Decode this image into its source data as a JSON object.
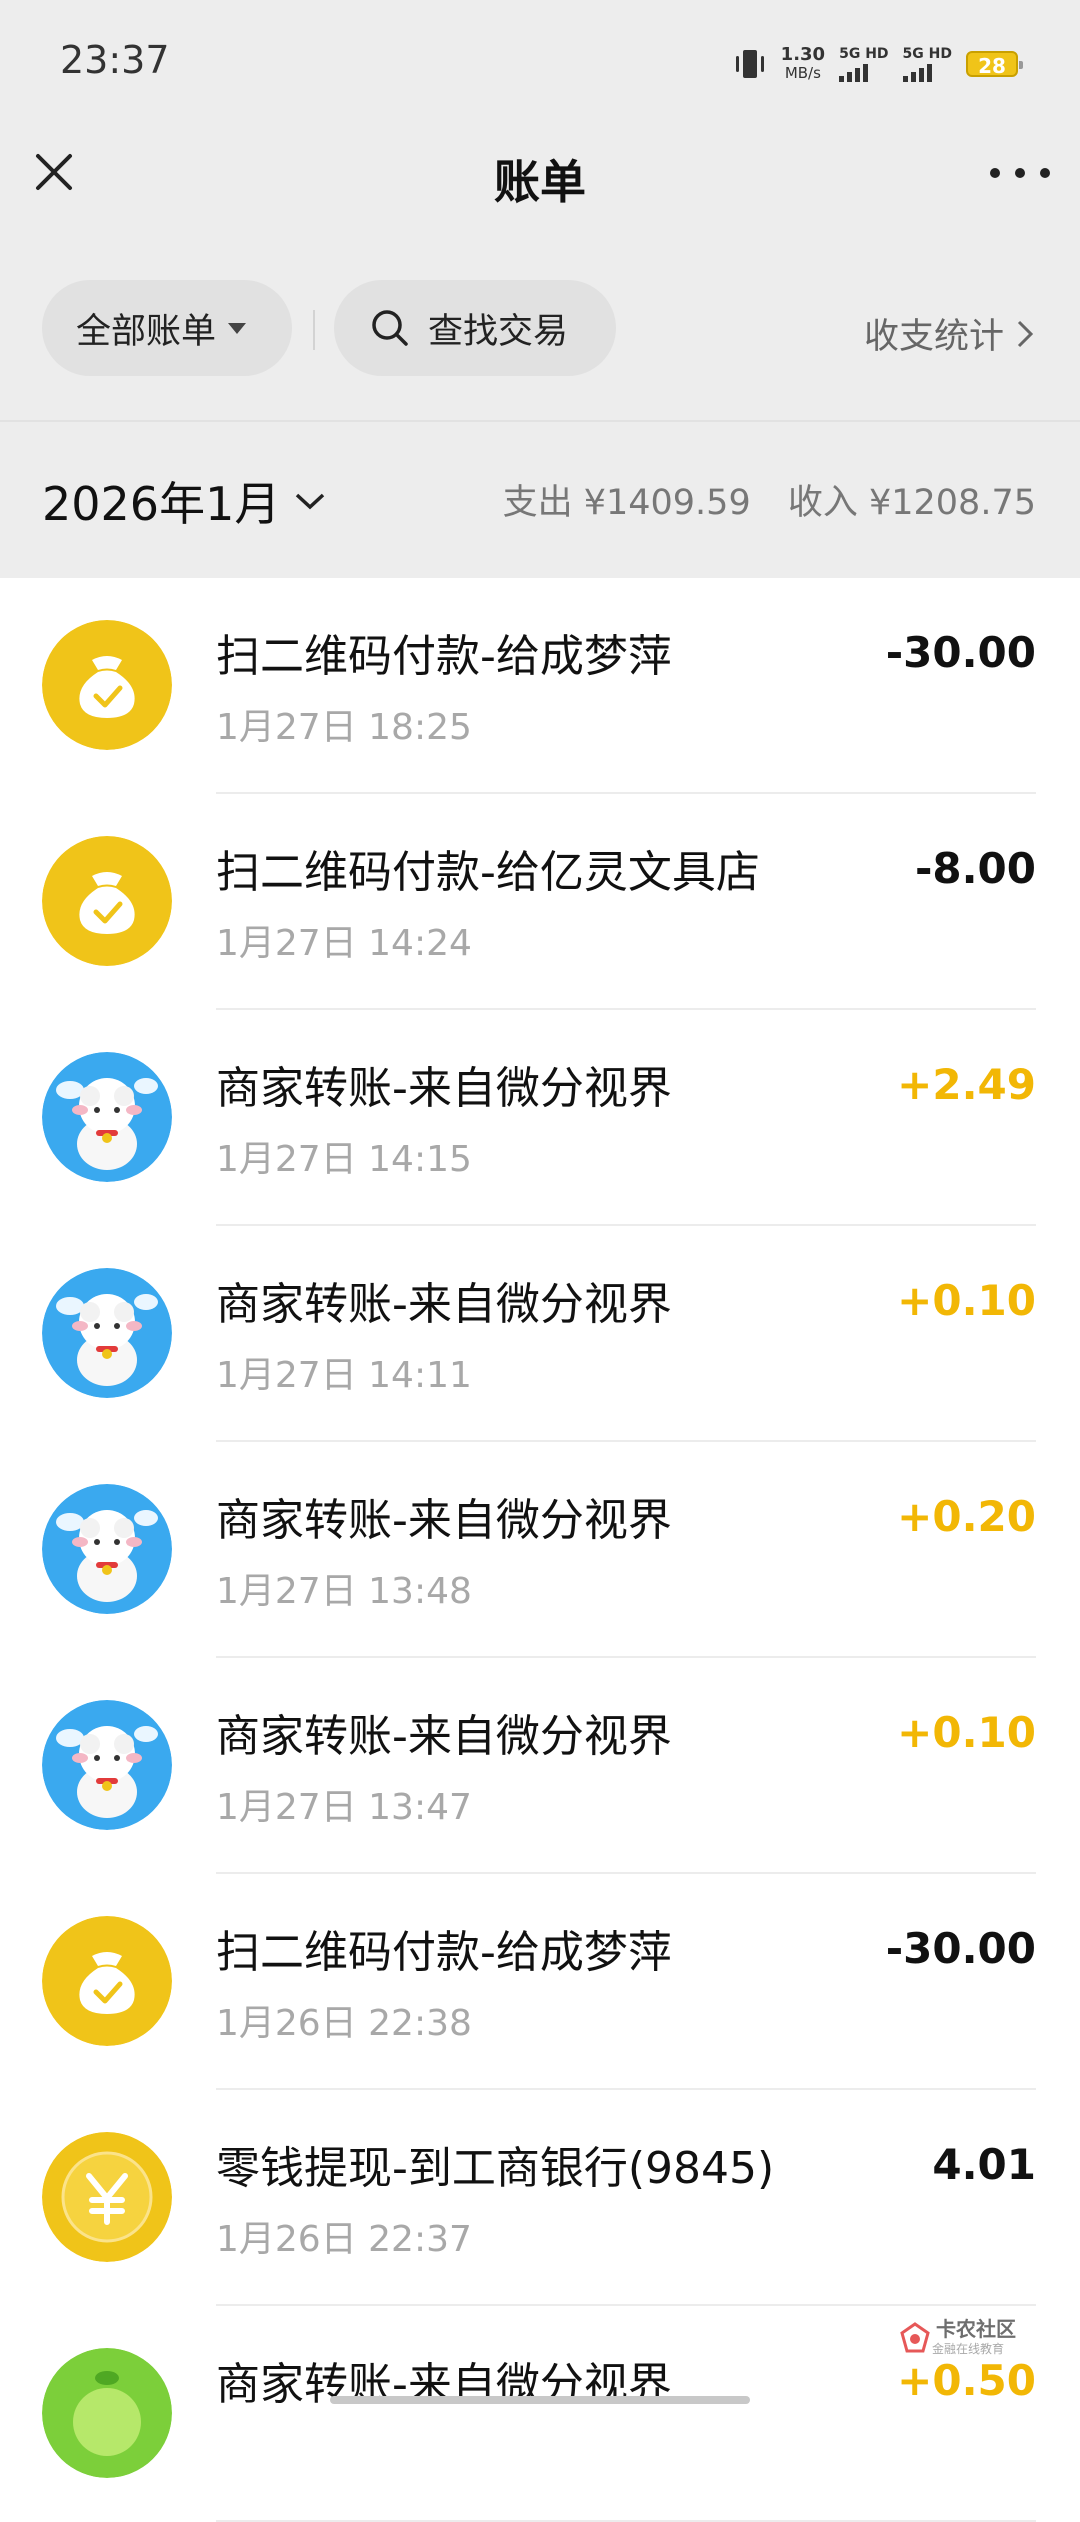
{
  "status_bar": {
    "time": "23:37",
    "speed_value": "1.30",
    "speed_unit": "MB/s",
    "sim1": "5G HD",
    "sim2": "5G HD",
    "battery": "28"
  },
  "header": {
    "title": "账单"
  },
  "filters": {
    "all_bills": "全部账单",
    "search": "查找交易",
    "stats": "收支统计"
  },
  "month": {
    "label": "2026年1月",
    "expense": "支出 ¥1409.59",
    "income": "收入 ¥1208.75"
  },
  "transactions": [
    {
      "title": "扫二维码付款-给成梦萍",
      "date": "1月27日 18:25",
      "amount": "-30.00",
      "avatar": "wallet-bag-icon"
    },
    {
      "title": "扫二维码付款-给亿灵文具店",
      "date": "1月27日 14:24",
      "amount": "-8.00",
      "avatar": "wallet-bag-icon"
    },
    {
      "title": "商家转账-来自微分视界",
      "date": "1月27日 14:15",
      "amount": "+2.49",
      "avatar": "sheep-avatar"
    },
    {
      "title": "商家转账-来自微分视界",
      "date": "1月27日 14:11",
      "amount": "+0.10",
      "avatar": "sheep-avatar"
    },
    {
      "title": "商家转账-来自微分视界",
      "date": "1月27日 13:48",
      "amount": "+0.20",
      "avatar": "sheep-avatar"
    },
    {
      "title": "商家转账-来自微分视界",
      "date": "1月27日 13:47",
      "amount": "+0.10",
      "avatar": "sheep-avatar"
    },
    {
      "title": "扫二维码付款-给成梦萍",
      "date": "1月26日 22:38",
      "amount": "-30.00",
      "avatar": "wallet-bag-icon"
    },
    {
      "title": "零钱提现-到工商银行(9845)",
      "date": "1月26日 22:37",
      "amount": "4.01",
      "avatar": "yuan-coin-icon"
    },
    {
      "title": "商家转账-来自微分视界",
      "date": "",
      "amount": "+0.50",
      "avatar": "green-avatar"
    }
  ],
  "watermark": {
    "name": "卡农社区",
    "tagline": "金融在线教育"
  },
  "colors": {
    "header_bg": "#ededed",
    "income": "#f2b705",
    "icon_yellow": "#f0c419"
  }
}
